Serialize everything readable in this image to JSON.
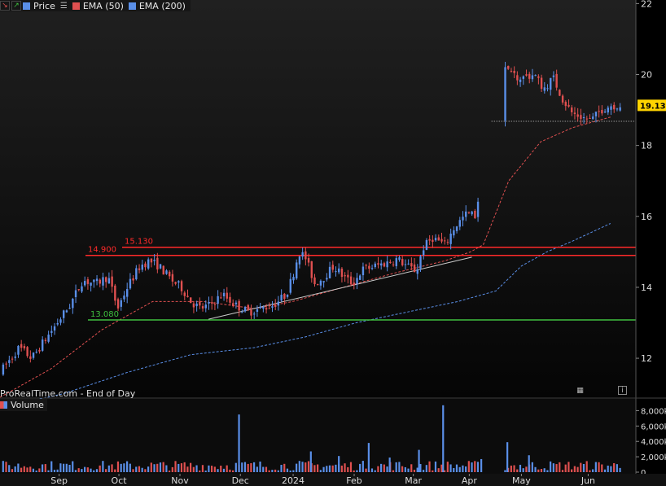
{
  "legend": {
    "tools": [
      {
        "icon": "red-arrow-down-icon",
        "glyph": "↘",
        "color": "#e05050"
      },
      {
        "icon": "green-arrow-up-icon",
        "glyph": "↗",
        "color": "#3fbf3f"
      }
    ],
    "items": [
      {
        "label": "Price",
        "color": "#5a8fe8",
        "icon": "price-swatch-icon"
      },
      {
        "label": "",
        "color": "#bbbbbb",
        "icon": "list-icon",
        "glyph": "☰"
      },
      {
        "label": "EMA (50)",
        "color": "#e05050",
        "icon": "ema50-swatch-icon"
      },
      {
        "label": "EMA (200)",
        "color": "#5a8fe8",
        "icon": "ema200-swatch-icon"
      }
    ]
  },
  "source_text": "ProRealTime.com - End of Day",
  "volume_legend": "Volume",
  "colors": {
    "up": "#5a8fe8",
    "down": "#e05050",
    "ema50": "#e05050",
    "ema200": "#5a8fe8",
    "resistance": "#ff2a2a",
    "support": "#3fbf3f",
    "trend": "#cccccc",
    "last_price_bg": "#ffd400"
  },
  "chart_data": [
    {
      "type": "candlestick",
      "title": "",
      "x_ticks": [
        "Sep",
        "Oct",
        "Nov",
        "Dec",
        "2024",
        "Feb",
        "Mar",
        "Apr",
        "May",
        "Jun"
      ],
      "y_ticks": [
        12,
        14,
        16,
        18,
        20,
        22
      ],
      "ylim": [
        10.9,
        22.1
      ],
      "last_price": "19.130",
      "last_price_value": 19.13,
      "horizontal_lines": [
        {
          "label": "15.130",
          "value": 15.13,
          "color": "#ff2a2a"
        },
        {
          "label": "14.900",
          "value": 14.9,
          "color": "#ff2a2a"
        },
        {
          "label": "13.080",
          "value": 13.08,
          "color": "#3fbf3f"
        }
      ],
      "trendline": {
        "start": [
          0.328,
          13.1
        ],
        "end": [
          0.742,
          14.85
        ]
      },
      "gap_line_value": 18.68,
      "close_path": [
        [
          0.0,
          11.6
        ],
        [
          0.03,
          12.3
        ],
        [
          0.05,
          12.0
        ],
        [
          0.07,
          12.5
        ],
        [
          0.09,
          13.0
        ],
        [
          0.11,
          13.5
        ],
        [
          0.13,
          14.2
        ],
        [
          0.15,
          14.1
        ],
        [
          0.17,
          14.3
        ],
        [
          0.185,
          13.4
        ],
        [
          0.2,
          14.0
        ],
        [
          0.22,
          14.6
        ],
        [
          0.235,
          14.75
        ],
        [
          0.25,
          14.6
        ],
        [
          0.27,
          14.2
        ],
        [
          0.285,
          14.0
        ],
        [
          0.3,
          13.6
        ],
        [
          0.315,
          13.4
        ],
        [
          0.33,
          13.5
        ],
        [
          0.35,
          13.8
        ],
        [
          0.37,
          13.5
        ],
        [
          0.39,
          13.3
        ],
        [
          0.41,
          13.4
        ],
        [
          0.43,
          13.5
        ],
        [
          0.45,
          13.8
        ],
        [
          0.46,
          14.3
        ],
        [
          0.47,
          15.0
        ],
        [
          0.48,
          14.85
        ],
        [
          0.495,
          14.1
        ],
        [
          0.51,
          14.3
        ],
        [
          0.525,
          14.6
        ],
        [
          0.54,
          14.3
        ],
        [
          0.555,
          14.1
        ],
        [
          0.57,
          14.5
        ],
        [
          0.59,
          14.6
        ],
        [
          0.61,
          14.7
        ],
        [
          0.625,
          14.8
        ],
        [
          0.64,
          14.6
        ],
        [
          0.655,
          14.45
        ],
        [
          0.665,
          15.1
        ],
        [
          0.68,
          15.4
        ],
        [
          0.7,
          15.2
        ],
        [
          0.715,
          15.7
        ],
        [
          0.735,
          16.1
        ],
        [
          0.75,
          16.0
        ],
        [
          0.76,
          18.7
        ],
        [
          0.77,
          20.0
        ],
        [
          0.785,
          20.9
        ],
        [
          0.8,
          20.0
        ],
        [
          0.82,
          19.9
        ],
        [
          0.84,
          20.0
        ],
        [
          0.855,
          19.6
        ],
        [
          0.87,
          19.9
        ],
        [
          0.885,
          19.3
        ],
        [
          0.9,
          18.9
        ],
        [
          0.915,
          18.8
        ],
        [
          0.93,
          18.7
        ],
        [
          0.945,
          19.0
        ],
        [
          0.96,
          19.13
        ]
      ],
      "ema50": [
        [
          0.0,
          10.9
        ],
        [
          0.08,
          11.7
        ],
        [
          0.16,
          12.8
        ],
        [
          0.24,
          13.6
        ],
        [
          0.32,
          13.6
        ],
        [
          0.4,
          13.4
        ],
        [
          0.46,
          13.6
        ],
        [
          0.54,
          14.0
        ],
        [
          0.62,
          14.4
        ],
        [
          0.7,
          14.75
        ],
        [
          0.74,
          15.0
        ],
        [
          0.76,
          15.2
        ],
        [
          0.8,
          17.0
        ],
        [
          0.85,
          18.1
        ],
        [
          0.9,
          18.5
        ],
        [
          0.93,
          18.65
        ],
        [
          0.96,
          18.8
        ]
      ],
      "ema200": [
        [
          0.0,
          10.6
        ],
        [
          0.1,
          11.0
        ],
        [
          0.2,
          11.6
        ],
        [
          0.3,
          12.1
        ],
        [
          0.4,
          12.3
        ],
        [
          0.48,
          12.6
        ],
        [
          0.56,
          13.0
        ],
        [
          0.64,
          13.3
        ],
        [
          0.72,
          13.6
        ],
        [
          0.78,
          13.9
        ],
        [
          0.82,
          14.6
        ],
        [
          0.86,
          15.0
        ],
        [
          0.9,
          15.3
        ],
        [
          0.96,
          15.8
        ]
      ]
    },
    {
      "type": "bar",
      "title": "Volume",
      "y_ticks": [
        "8,000k",
        "6,000k",
        "4,000k",
        "2,000k",
        "0"
      ],
      "y_tick_values": [
        8000,
        6000,
        4000,
        2000,
        0
      ],
      "ylim": [
        0,
        9000
      ],
      "spikes": [
        {
          "x": 0.376,
          "value": 7500
        },
        {
          "x": 0.489,
          "value": 2700
        },
        {
          "x": 0.533,
          "value": 2100
        },
        {
          "x": 0.58,
          "value": 3800
        },
        {
          "x": 0.613,
          "value": 1900
        },
        {
          "x": 0.659,
          "value": 2900
        },
        {
          "x": 0.697,
          "value": 8700
        },
        {
          "x": 0.757,
          "value": 1700
        },
        {
          "x": 0.798,
          "value": 3900
        },
        {
          "x": 0.832,
          "value": 2200
        }
      ],
      "base_range": [
        200,
        1500
      ]
    }
  ]
}
